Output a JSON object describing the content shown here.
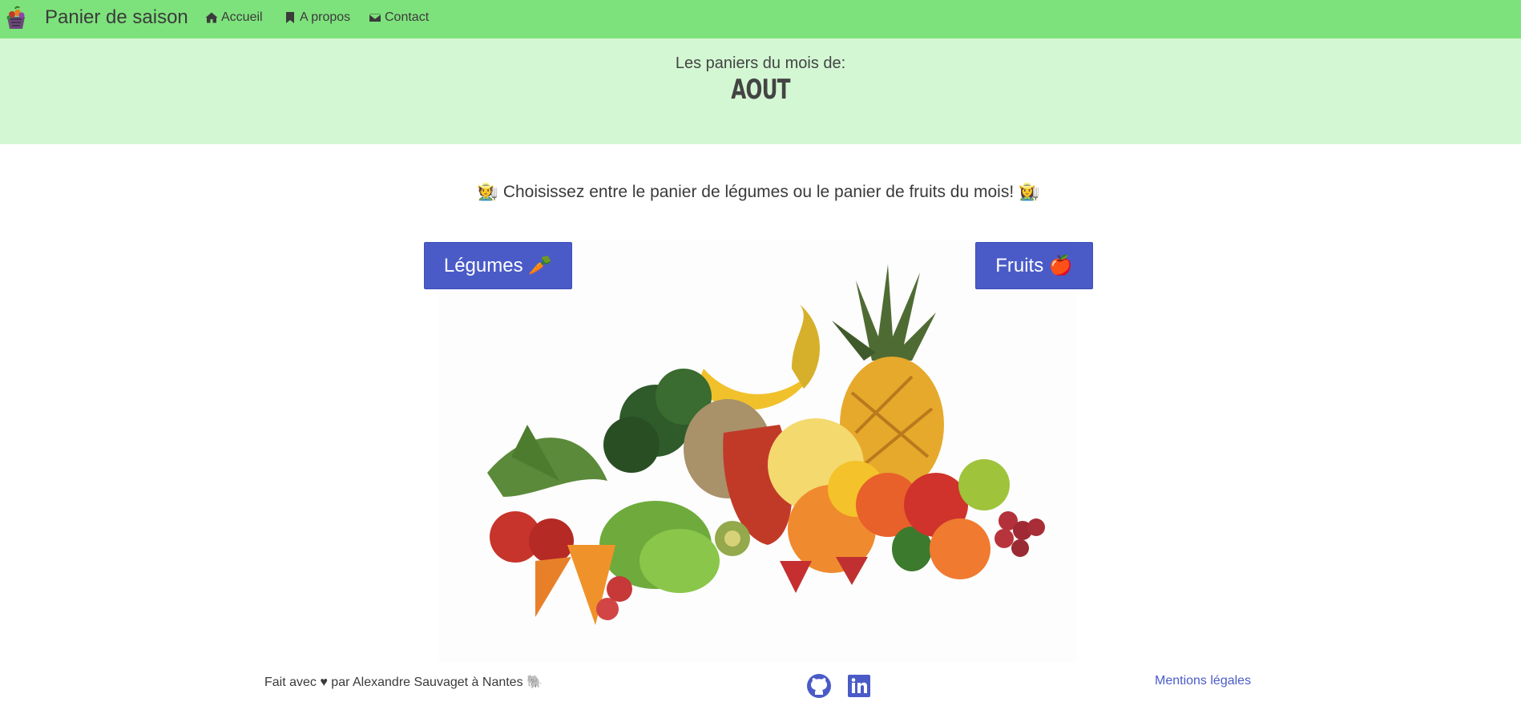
{
  "navbar": {
    "brand": "Panier de saison",
    "links": [
      {
        "label": "Accueil",
        "icon": "home-icon"
      },
      {
        "label": "A propos",
        "icon": "bookmark-icon"
      },
      {
        "label": "Contact",
        "icon": "envelope-icon"
      }
    ],
    "background": "#7ee27c"
  },
  "banner": {
    "subtitle": "Les paniers du mois de:",
    "month": "AOUT",
    "background": "#d3f7d3"
  },
  "main": {
    "choice_text": "🧑‍🌾 Choisissez entre le panier de légumes ou le panier de fruits du mois! 👩‍🌾",
    "buttons": {
      "legumes": "Légumes 🥕",
      "fruits": "Fruits 🍎"
    },
    "hero_image": "fruits-and-vegetables-illustration",
    "accent": "#4a5bc8"
  },
  "footer": {
    "credit": "Fait avec ♥ par Alexandre Sauvaget à Nantes 🐘",
    "legal_link": "Mentions légales",
    "social": [
      "github-icon",
      "linkedin-icon"
    ]
  }
}
